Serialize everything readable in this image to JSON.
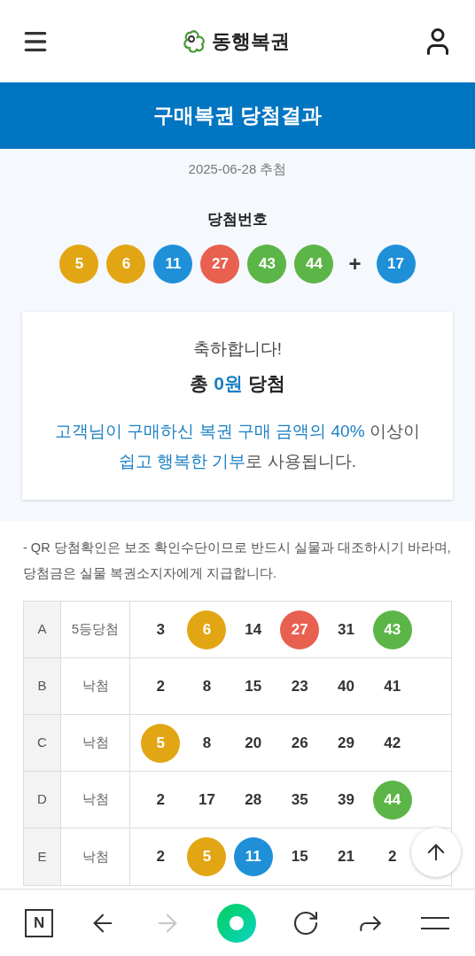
{
  "header": {
    "logo_text": "동행복권"
  },
  "banner": {
    "title": "구매복권 당첨결과"
  },
  "draw": {
    "date": "2025-06-28 추첨",
    "label": "당첨번호",
    "plus": "+",
    "balls": [
      {
        "number": "5",
        "color": "#e2a614"
      },
      {
        "number": "6",
        "color": "#e2a614"
      },
      {
        "number": "11",
        "color": "#1f8fd8"
      },
      {
        "number": "27",
        "color": "#e8604f"
      },
      {
        "number": "43",
        "color": "#5cb547"
      },
      {
        "number": "44",
        "color": "#5cb547"
      }
    ],
    "bonus": {
      "number": "17",
      "color": "#1f8fd8"
    }
  },
  "result_card": {
    "greeting": "축하합니다!",
    "total": [
      {
        "text": "총 ",
        "highlight": false
      },
      {
        "text": "0원",
        "highlight": true
      },
      {
        "text": " 당첨",
        "highlight": false
      }
    ],
    "message_lines": [
      [
        {
          "text": "고객님이 구매하신 복권 구매 금액의 40%",
          "highlight": true
        },
        {
          "text": " 이상이",
          "highlight": false
        }
      ],
      [
        {
          "text": "쉽고 행복한 기부",
          "highlight": true
        },
        {
          "text": "로 사용됩니다.",
          "highlight": false
        }
      ]
    ]
  },
  "notice": "- QR 당첨확인은 보조 확인수단이므로 반드시 실물과 대조하시기 바라며, 당첨금은 실물 복권소지자에게 지급합니다.",
  "table": {
    "rows": [
      {
        "game": "A",
        "result": "5등당첨",
        "numbers": [
          {
            "value": "3",
            "matched": false
          },
          {
            "value": "6",
            "matched": true,
            "color": "#e2a614"
          },
          {
            "value": "14",
            "matched": false
          },
          {
            "value": "27",
            "matched": true,
            "color": "#e8604f"
          },
          {
            "value": "31",
            "matched": false
          },
          {
            "value": "43",
            "matched": true,
            "color": "#5cb547"
          }
        ]
      },
      {
        "game": "B",
        "result": "낙첨",
        "numbers": [
          {
            "value": "2",
            "matched": false
          },
          {
            "value": "8",
            "matched": false
          },
          {
            "value": "15",
            "matched": false
          },
          {
            "value": "23",
            "matched": false
          },
          {
            "value": "40",
            "matched": false
          },
          {
            "value": "41",
            "matched": false
          }
        ]
      },
      {
        "game": "C",
        "result": "낙첨",
        "numbers": [
          {
            "value": "5",
            "matched": true,
            "color": "#e2a614"
          },
          {
            "value": "8",
            "matched": false
          },
          {
            "value": "20",
            "matched": false
          },
          {
            "value": "26",
            "matched": false
          },
          {
            "value": "29",
            "matched": false
          },
          {
            "value": "42",
            "matched": false
          }
        ]
      },
      {
        "game": "D",
        "result": "낙첨",
        "numbers": [
          {
            "value": "2",
            "matched": false
          },
          {
            "value": "17",
            "matched": false
          },
          {
            "value": "28",
            "matched": false
          },
          {
            "value": "35",
            "matched": false
          },
          {
            "value": "39",
            "matched": false
          },
          {
            "value": "44",
            "matched": true,
            "color": "#5cb547"
          }
        ]
      },
      {
        "game": "E",
        "result": "낙첨",
        "numbers": [
          {
            "value": "2",
            "matched": false
          },
          {
            "value": "5",
            "matched": true,
            "color": "#e2a614"
          },
          {
            "value": "11",
            "matched": true,
            "color": "#1f8fd8"
          },
          {
            "value": "15",
            "matched": false
          },
          {
            "value": "21",
            "matched": false
          },
          {
            "value": "2",
            "matched": false
          }
        ]
      }
    ]
  },
  "browser_bar": {
    "home_letter": "N",
    "forward_disabled": true
  }
}
